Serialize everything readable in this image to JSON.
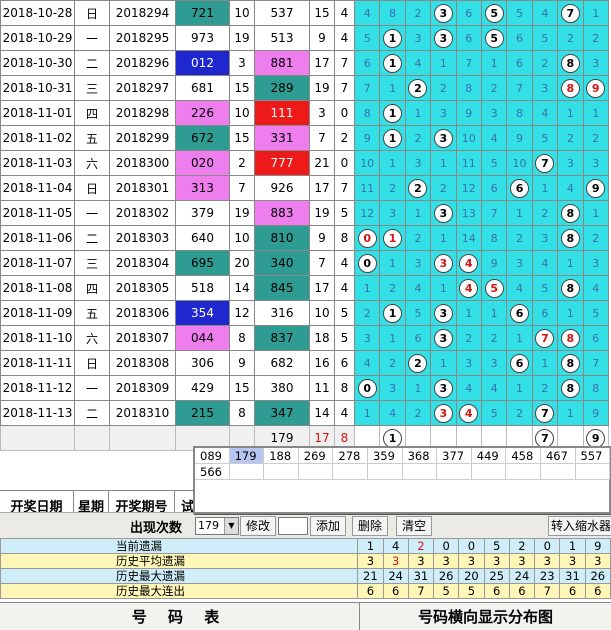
{
  "rows": [
    {
      "date": "2018-10-28",
      "week": "日",
      "issue": "2018294",
      "test": "721",
      "test_bg": "tl",
      "span": "10",
      "num": "537",
      "num_bg": "",
      "sum": "15",
      "last": "4",
      "dist": [
        "4",
        "8",
        "2",
        "b:3",
        "6",
        "b:5",
        "5",
        "4",
        "b:7",
        "1"
      ]
    },
    {
      "date": "2018-10-29",
      "week": "一",
      "issue": "2018295",
      "test": "973",
      "test_bg": "",
      "span": "19",
      "num": "513",
      "num_bg": "",
      "sum": "9",
      "last": "4",
      "dist": [
        "5",
        "b:1",
        "3",
        "b:3",
        "6",
        "b:5",
        "6",
        "5",
        "2",
        "2"
      ]
    },
    {
      "date": "2018-10-30",
      "week": "二",
      "issue": "2018296",
      "test": "012",
      "test_bg": "bl",
      "span": "3",
      "num": "881",
      "num_bg": "pk",
      "sum": "17",
      "last": "7",
      "dist": [
        "6",
        "b:1",
        "4",
        "1",
        "7",
        "1",
        "6",
        "2",
        "b:8",
        "3"
      ]
    },
    {
      "date": "2018-10-31",
      "week": "三",
      "issue": "2018297",
      "test": "681",
      "test_bg": "",
      "span": "15",
      "num": "289",
      "num_bg": "tl",
      "sum": "19",
      "last": "7",
      "dist": [
        "7",
        "1",
        "b:2",
        "2",
        "8",
        "2",
        "7",
        "3",
        "r:8",
        "r:9"
      ]
    },
    {
      "date": "2018-11-01",
      "week": "四",
      "issue": "2018298",
      "test": "226",
      "test_bg": "pk",
      "span": "10",
      "num": "111",
      "num_bg": "rd",
      "sum": "3",
      "last": "0",
      "dist": [
        "8",
        "b:1",
        "1",
        "3",
        "9",
        "3",
        "8",
        "4",
        "1",
        "1"
      ]
    },
    {
      "date": "2018-11-02",
      "week": "五",
      "issue": "2018299",
      "test": "672",
      "test_bg": "tl",
      "span": "15",
      "num": "331",
      "num_bg": "pk",
      "sum": "7",
      "last": "2",
      "dist": [
        "9",
        "b:1",
        "2",
        "b:3",
        "10",
        "4",
        "9",
        "5",
        "2",
        "2"
      ]
    },
    {
      "date": "2018-11-03",
      "week": "六",
      "issue": "2018300",
      "test": "020",
      "test_bg": "pk",
      "span": "2",
      "num": "777",
      "num_bg": "rd",
      "sum": "21",
      "last": "0",
      "dist": [
        "10",
        "1",
        "3",
        "1",
        "11",
        "5",
        "10",
        "b:7",
        "3",
        "3"
      ]
    },
    {
      "date": "2018-11-04",
      "week": "日",
      "issue": "2018301",
      "test": "313",
      "test_bg": "pk",
      "span": "7",
      "num": "926",
      "num_bg": "",
      "sum": "17",
      "last": "7",
      "dist": [
        "11",
        "2",
        "b:2",
        "2",
        "12",
        "6",
        "b:6",
        "1",
        "4",
        "b:9"
      ]
    },
    {
      "date": "2018-11-05",
      "week": "一",
      "issue": "2018302",
      "test": "379",
      "test_bg": "",
      "span": "19",
      "num": "883",
      "num_bg": "pk",
      "sum": "19",
      "last": "5",
      "dist": [
        "12",
        "3",
        "1",
        "b:3",
        "13",
        "7",
        "1",
        "2",
        "b:8",
        "1"
      ]
    },
    {
      "date": "2018-11-06",
      "week": "二",
      "issue": "2018303",
      "test": "640",
      "test_bg": "",
      "span": "10",
      "num": "810",
      "num_bg": "tl",
      "sum": "9",
      "last": "8",
      "dist": [
        "r:0",
        "r:1",
        "2",
        "1",
        "14",
        "8",
        "2",
        "3",
        "b:8",
        "2"
      ]
    },
    {
      "date": "2018-11-07",
      "week": "三",
      "issue": "2018304",
      "test": "695",
      "test_bg": "tl",
      "span": "20",
      "num": "340",
      "num_bg": "tl",
      "sum": "7",
      "last": "4",
      "dist": [
        "b:0",
        "1",
        "3",
        "r:3",
        "r:4",
        "9",
        "3",
        "4",
        "1",
        "3"
      ]
    },
    {
      "date": "2018-11-08",
      "week": "四",
      "issue": "2018305",
      "test": "518",
      "test_bg": "",
      "span": "14",
      "num": "845",
      "num_bg": "tl",
      "sum": "17",
      "last": "4",
      "dist": [
        "1",
        "2",
        "4",
        "1",
        "r:4",
        "r:5",
        "4",
        "5",
        "b:8",
        "4"
      ]
    },
    {
      "date": "2018-11-09",
      "week": "五",
      "issue": "2018306",
      "test": "354",
      "test_bg": "bl",
      "span": "12",
      "num": "316",
      "num_bg": "",
      "sum": "10",
      "last": "5",
      "dist": [
        "2",
        "b:1",
        "5",
        "b:3",
        "1",
        "1",
        "b:6",
        "6",
        "1",
        "5"
      ]
    },
    {
      "date": "2018-11-10",
      "week": "六",
      "issue": "2018307",
      "test": "044",
      "test_bg": "pk",
      "span": "8",
      "num": "837",
      "num_bg": "tl",
      "sum": "18",
      "last": "5",
      "dist": [
        "3",
        "1",
        "6",
        "b:3",
        "2",
        "2",
        "1",
        "r:7",
        "r:8",
        "6"
      ]
    },
    {
      "date": "2018-11-11",
      "week": "日",
      "issue": "2018308",
      "test": "306",
      "test_bg": "",
      "span": "9",
      "num": "682",
      "num_bg": "",
      "sum": "16",
      "last": "6",
      "dist": [
        "4",
        "2",
        "b:2",
        "1",
        "3",
        "3",
        "b:6",
        "1",
        "b:8",
        "7"
      ]
    },
    {
      "date": "2018-11-12",
      "week": "一",
      "issue": "2018309",
      "test": "429",
      "test_bg": "",
      "span": "15",
      "num": "380",
      "num_bg": "",
      "sum": "11",
      "last": "8",
      "dist": [
        "b:0",
        "3",
        "1",
        "b:3",
        "4",
        "4",
        "1",
        "2",
        "b:8",
        "8"
      ]
    },
    {
      "date": "2018-11-13",
      "week": "二",
      "issue": "2018310",
      "test": "215",
      "test_bg": "tl",
      "span": "8",
      "num": "347",
      "num_bg": "tl",
      "sum": "14",
      "last": "4",
      "dist": [
        "1",
        "4",
        "2",
        "r:3",
        "r:4",
        "5",
        "2",
        "b:7",
        "1",
        "9"
      ]
    }
  ],
  "bottom_row": {
    "num": "179",
    "sum": "17",
    "last": "8",
    "dist": [
      "",
      "b:1",
      "",
      "",
      "",
      "",
      "",
      "b:7",
      "",
      "b:9"
    ]
  },
  "header": {
    "date": "开奖日期",
    "week": "星期",
    "issue": "开奖期号",
    "test": "试"
  },
  "popup_list": [
    "089",
    "179",
    "188",
    "269",
    "278",
    "359",
    "368",
    "377",
    "449",
    "458",
    "467",
    "557",
    "566"
  ],
  "popup_selected": "179",
  "toolbar": {
    "count_label": "出现次数",
    "select_value": "179",
    "edit": "修改",
    "add": "添加",
    "delete": "删除",
    "clear": "清空",
    "transfer": "转入缩水器"
  },
  "stats": [
    {
      "label": "当前遗漏",
      "values": [
        "1",
        "4",
        "2",
        "0",
        "0",
        "5",
        "2",
        "0",
        "1",
        "9"
      ],
      "red": [
        2
      ]
    },
    {
      "label": "历史平均遗漏",
      "values": [
        "3",
        "3",
        "3",
        "3",
        "3",
        "3",
        "3",
        "3",
        "3",
        "3"
      ],
      "red": [
        1
      ]
    },
    {
      "label": "历史最大遗漏",
      "values": [
        "21",
        "24",
        "31",
        "26",
        "20",
        "25",
        "24",
        "23",
        "31",
        "26"
      ],
      "red": []
    },
    {
      "label": "历史最大连出",
      "values": [
        "6",
        "6",
        "7",
        "5",
        "5",
        "6",
        "6",
        "7",
        "6",
        "6"
      ],
      "red": []
    }
  ],
  "footer": {
    "left": "号 码 表",
    "right": "号码横向显示分布图"
  },
  "colors": {
    "grid": "#33e0e6",
    "blue": "#1f28cf",
    "pink": "#ee7ded",
    "teal": "#2f9c94",
    "red": "#ee1a1a",
    "stat1": "#cfeefa",
    "stat2": "#fff6b8"
  }
}
